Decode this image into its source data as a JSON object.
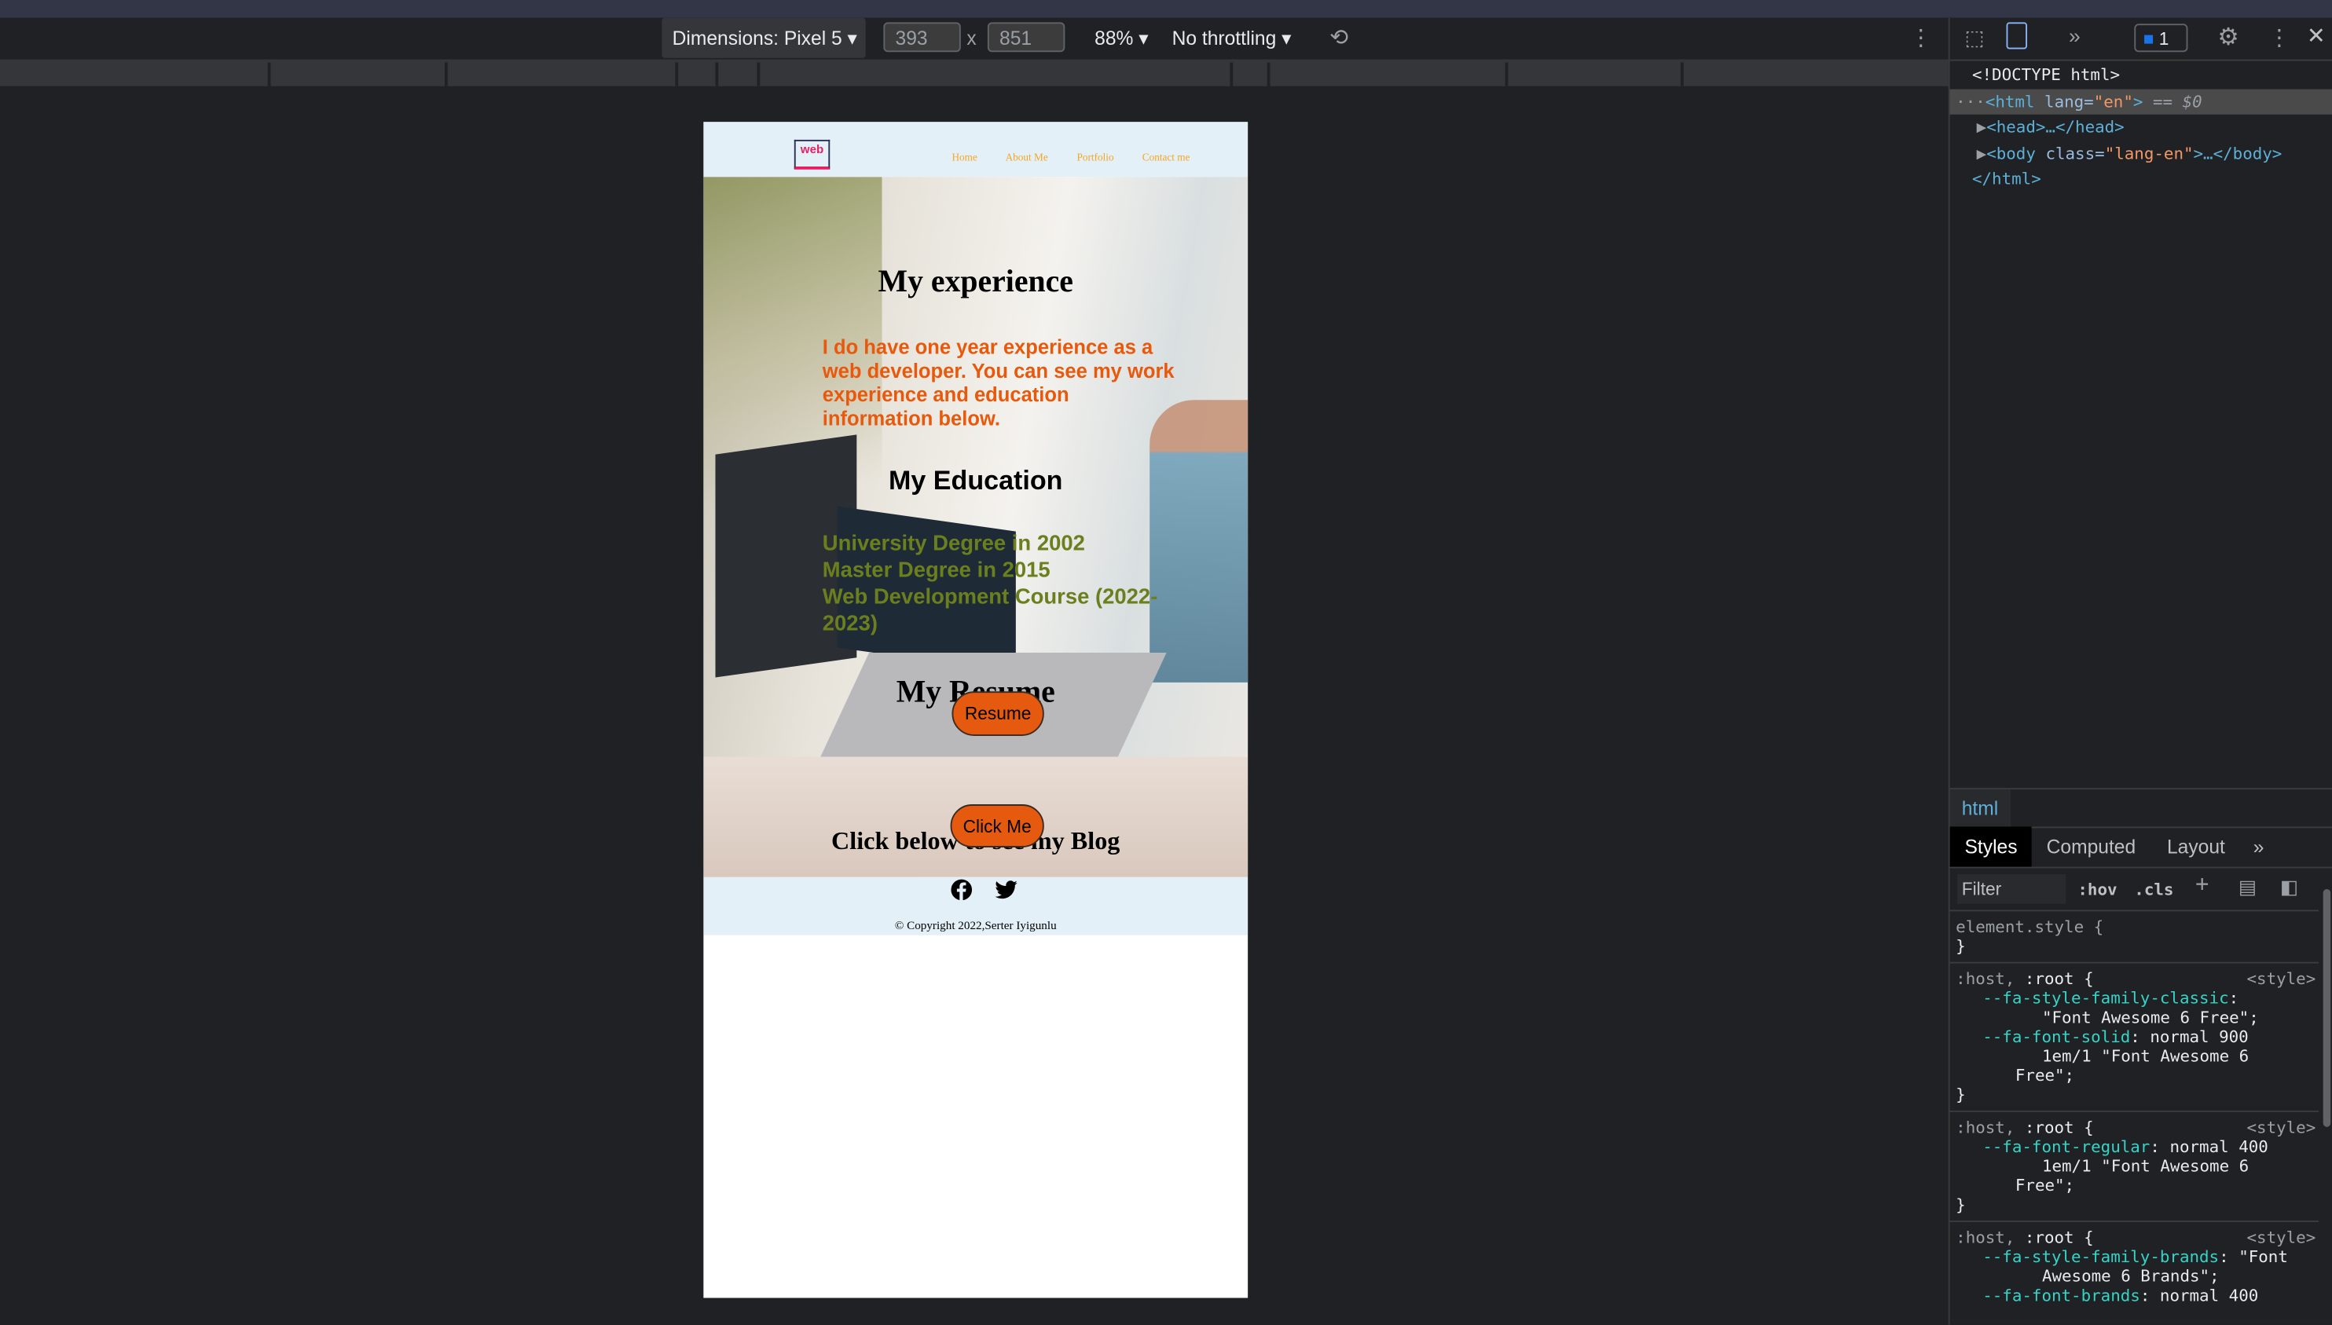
{
  "devtools_toolbar": {
    "device_label": "Dimensions: Pixel 5",
    "width": "393",
    "height": "851",
    "times": "x",
    "zoom": "88%",
    "throttling": "No throttling"
  },
  "page": {
    "logo_text": "web",
    "nav": [
      "Home",
      "About Me",
      "Portfolio",
      "Contact me"
    ],
    "experience_heading": "My experience",
    "experience_text": "I do have one year experience as a web developer. You can see my work experience and education information below.",
    "education_heading": "My Education",
    "education_items": [
      "University Degree in 2002",
      "Master Degree in 2015",
      "Web Development Course (2022-2023)"
    ],
    "resume_heading": "My Resume",
    "resume_button": "Resume",
    "blog_heading": "Click below to see my Blog",
    "blog_button": "Click Me",
    "copyright": "© Copyright 2022,Serter Iyigunlu",
    "colors": {
      "orange": "#e8590c",
      "green": "#6b7f1e",
      "nav": "#f5a623",
      "header_bg": "#e4f0f7"
    }
  },
  "devtools": {
    "issues_count": "1",
    "dom": {
      "doctype": "<!DOCTYPE html>",
      "html_open_tag": "<html ",
      "html_attr": "lang=",
      "html_val": "\"en\"",
      "html_close": ">",
      "selected_marker": " == $0",
      "head": "<head>…</head>",
      "body_tag": "<body ",
      "body_attr": "class=",
      "body_val": "\"lang-en\"",
      "body_close": ">…</body>",
      "html_end": "</html>"
    },
    "breadcrumb": "html",
    "tabs": [
      "Styles",
      "Computed",
      "Layout"
    ],
    "filter_placeholder": "Filter",
    "hov": ":hov",
    "cls": ".cls",
    "rules": {
      "element_style": "element.style {",
      "close": "}",
      "host_sel": ":host, ",
      "root_sel": ":root {",
      "source": "<style>",
      "r1_p1": "--fa-style-family-classic",
      "r1_v1": "\"Font Awesome 6 Free\";",
      "r1_p2": "--fa-font-solid",
      "r1_v2a": "normal 900",
      "r1_v2b": "1em/1 \"Font Awesome 6",
      "r1_v2c": "Free\";",
      "r2_p1": "--fa-font-regular",
      "r2_v1a": "normal 400",
      "r2_v1b": "1em/1 \"Font Awesome 6",
      "r2_v1c": "Free\";",
      "r3_p1": "--fa-style-family-brands",
      "r3_v1a": "\"Font",
      "r3_v1b": "Awesome 6 Brands\";",
      "r3_p2": "--fa-font-brands",
      "r3_v2": "normal 400"
    }
  }
}
